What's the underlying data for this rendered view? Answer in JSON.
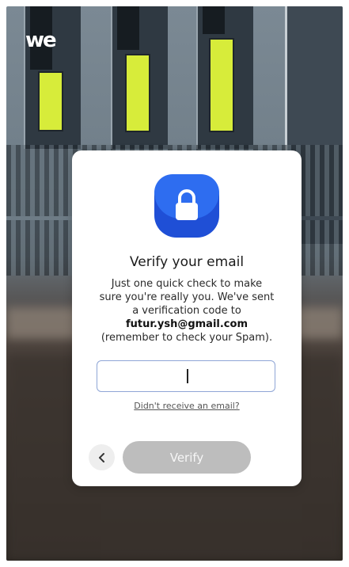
{
  "brand": {
    "logo_text": "we"
  },
  "dialog": {
    "icon": "lock-icon",
    "title": "Verify your email",
    "message_lines": [
      "Just one quick check to make",
      "sure you're really you. We've sent",
      "a verification code to"
    ],
    "email": "futur.ysh@gmail.com",
    "note": "(remember to check your Spam).",
    "code_input": {
      "value": "",
      "placeholder": ""
    },
    "resend_link": "Didn't receive an email?",
    "back_icon": "chevron-left-icon",
    "verify_label": "Verify"
  },
  "colors": {
    "accent": "#1f4fd6",
    "button_disabled": "#bdbdbd",
    "input_border": "#8fa6d6"
  }
}
